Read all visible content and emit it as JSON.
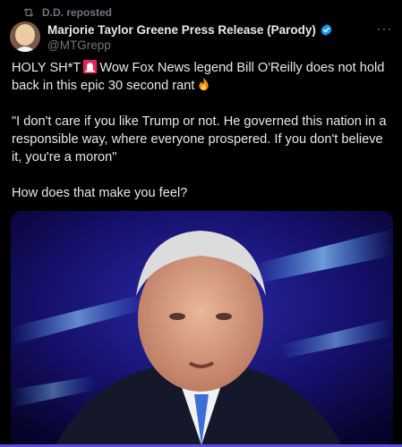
{
  "repost": {
    "text": "D.D. reposted",
    "icon": "repost-icon"
  },
  "author": {
    "name": "Marjorie Taylor Greene Press Release (Parody)",
    "handle": "@MTGrepp",
    "verified_color": "#1d9bf0"
  },
  "more_label": "···",
  "tweet": {
    "line1_a": "HOLY SH*T",
    "line1_b": "Wow Fox News legend Bill O'Reilly does not hold back in this epic 30 second rant",
    "quote": "\"I don't care if you like Trump or not. He governed this nation in a responsible way, where everyone prospered. If you don't believe it, you're a moron\"",
    "question": "How does that make you feel?",
    "emojis": [
      "siren-emoji",
      "fire-emoji"
    ]
  },
  "media": {
    "kind": "video-still",
    "accent": "#1c1a7a"
  }
}
